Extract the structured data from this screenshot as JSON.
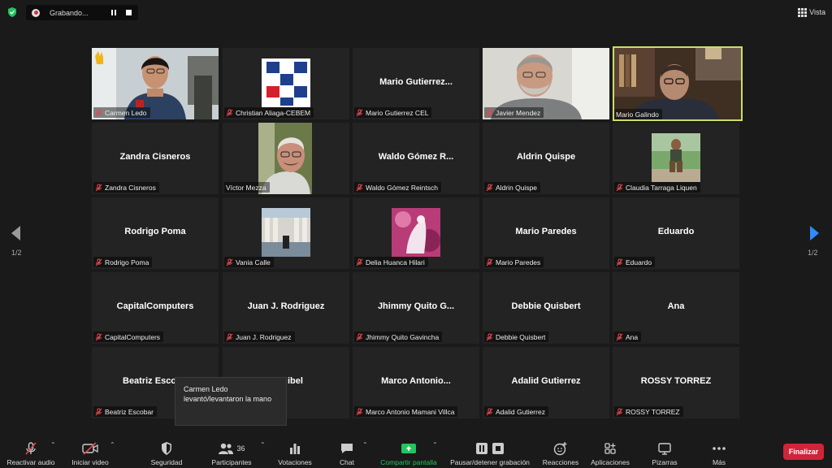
{
  "recording": {
    "status": "Grabando..."
  },
  "view": {
    "label": "Vista"
  },
  "pagination": {
    "left": "1/2",
    "right": "1/2"
  },
  "tooltip": {
    "text": "Carmen Ledo levantó/levantaron la mano"
  },
  "participants_count": "36",
  "tiles": [
    {
      "name": "",
      "label": "Carmen Ledo"
    },
    {
      "name": "",
      "label": "Christian Aliaga-CEBEM"
    },
    {
      "name": "Mario  Gutierrez...",
      "label": "Mario Gutierrez CEL"
    },
    {
      "name": "",
      "label": "Javier Mendez"
    },
    {
      "name": "",
      "label": "Mario Galindo"
    },
    {
      "name": "Zandra Cisneros",
      "label": "Zandra Cisneros"
    },
    {
      "name": "",
      "label": "Víctor Mezza"
    },
    {
      "name": "Waldo Gómez R...",
      "label": "Waldo Gómez Reintsch"
    },
    {
      "name": "Aldrin Quispe",
      "label": "Aldrin Quispe"
    },
    {
      "name": "",
      "label": "Claudia Tarraga Liquen"
    },
    {
      "name": "Rodrigo Poma",
      "label": "Rodrigo Poma"
    },
    {
      "name": "",
      "label": "Vania Calle"
    },
    {
      "name": "",
      "label": "Delia Huanca Hilari"
    },
    {
      "name": "Mario Paredes",
      "label": "Mario Paredes"
    },
    {
      "name": "Eduardo",
      "label": "Eduardo"
    },
    {
      "name": "CapitalComputers",
      "label": "CapitalComputers"
    },
    {
      "name": "Juan J. Rodriguez",
      "label": "Juan J. Rodriguez"
    },
    {
      "name": "Jhimmy Quito G...",
      "label": "Jhimmy Quito Gavincha"
    },
    {
      "name": "Debbie Quisbert",
      "label": "Debbie Quisbert"
    },
    {
      "name": "Ana",
      "label": "Ana"
    },
    {
      "name": "Beatriz Esco",
      "label": "Beatriz Escobar"
    },
    {
      "name": "ibel",
      "label": ""
    },
    {
      "name": "Marco   Antonio...",
      "label": "Marco  Antonio Mamani Villca"
    },
    {
      "name": "Adalid Gutierrez",
      "label": "Adalid Gutierrez"
    },
    {
      "name": "ROSSY TORREZ",
      "label": "ROSSY TORREZ"
    }
  ],
  "toolbar": {
    "unmute": "Reactivar audio",
    "start_video": "Iniciar video",
    "security": "Seguridad",
    "participants": "Participantes",
    "polls": "Votaciones",
    "chat": "Chat",
    "share": "Compartir pantalla",
    "record": "Pausar/detener grabación",
    "reactions": "Reacciones",
    "apps": "Aplicaciones",
    "whiteboards": "Pizarras",
    "more": "Más",
    "end": "Finalizar"
  },
  "colors": {
    "accent": "#2d8cff",
    "share": "#22c55e",
    "end": "#d0243a",
    "speaking_border": "#c8df6c"
  }
}
